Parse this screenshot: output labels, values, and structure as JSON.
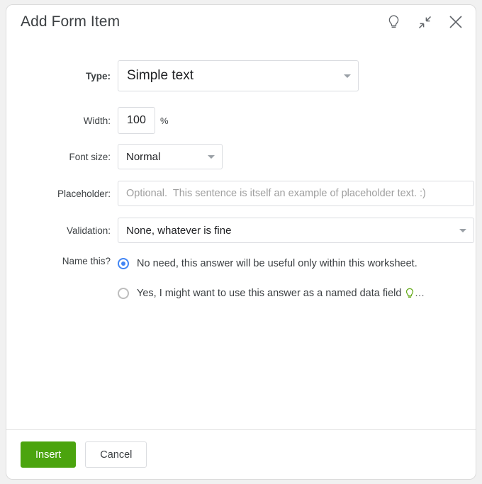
{
  "dialog": {
    "title": "Add Form Item",
    "header_icons": [
      {
        "name": "lightbulb-icon",
        "label": "Tips"
      },
      {
        "name": "collapse-icon",
        "label": "Collapse"
      },
      {
        "name": "close-icon",
        "label": "Close"
      }
    ]
  },
  "form": {
    "type": {
      "label": "Type:",
      "value": "Simple text"
    },
    "width": {
      "label": "Width:",
      "value": "100",
      "unit": "%"
    },
    "font_size": {
      "label": "Font size:",
      "value": "Normal"
    },
    "placeholder": {
      "label": "Placeholder:",
      "value": "",
      "placeholder": "Optional.  This sentence is itself an example of placeholder text. :)"
    },
    "validation": {
      "label": "Validation:",
      "value": "None, whatever is fine"
    },
    "name_this": {
      "label": "Name this?",
      "options": [
        {
          "text": "No need, this answer will be useful only within this worksheet.",
          "selected": true,
          "hint_icon": false,
          "trailing": ""
        },
        {
          "text": "Yes, I might want to use this answer as a named data field",
          "selected": false,
          "hint_icon": true,
          "trailing": "..."
        }
      ]
    }
  },
  "footer": {
    "insert_label": "Insert",
    "cancel_label": "Cancel"
  },
  "colors": {
    "accent_green": "#4ba40e",
    "radio_blue": "#4285f4",
    "hint_bulb_green": "#66ab1c",
    "icon_gray": "#5f6368",
    "border": "#dadce0"
  }
}
